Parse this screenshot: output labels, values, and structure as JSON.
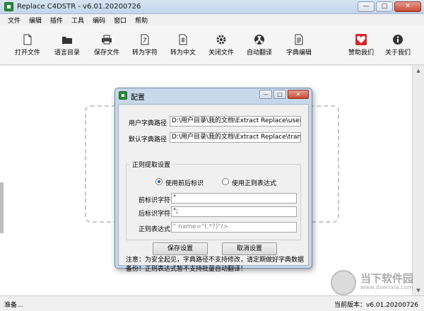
{
  "window": {
    "title": "Replace C4DSTR - v6.01.20200726",
    "minimize": "—",
    "maximize": "□",
    "close": "✕"
  },
  "menu": [
    "文件",
    "编辑",
    "插件",
    "工具",
    "编码",
    "窗口",
    "帮助"
  ],
  "toolbar": [
    {
      "label": "打开文件",
      "icon": "file-icon"
    },
    {
      "label": "语言目录",
      "icon": "folder-icon"
    },
    {
      "label": "保存文件",
      "icon": "printer-icon"
    },
    {
      "label": "转为字符",
      "icon": "convert-icon"
    },
    {
      "label": "转为中文",
      "icon": "convert-doc-icon"
    },
    {
      "label": "关闭文件",
      "icon": "gear-icon"
    },
    {
      "label": "自动翻译",
      "icon": "radiation-icon"
    },
    {
      "label": "字典编辑",
      "icon": "document-icon"
    },
    {
      "label": "赞助我们",
      "icon": "heart-icon"
    },
    {
      "label": "关于我们",
      "icon": "info-icon"
    }
  ],
  "status": {
    "left": "准备...",
    "right": "当前版本：v6.01.20200726"
  },
  "watermark": {
    "name": "当下软件园",
    "url": "www.downxia.com"
  },
  "dialog": {
    "title": "配置",
    "minimize": "—",
    "maximize": "□",
    "close": "✕",
    "user_dict_label": "用户字典路径",
    "user_dict_value": "D:\\用户目录\\我的文档\\Extract Replace\\user_t",
    "default_dict_label": "默认字典路径",
    "default_dict_value": "D:\\用户目录\\我的文档\\Extract Replace\\transla",
    "group_title": "正则提取设置",
    "radio_prefix_suffix": "使用前后标识",
    "radio_regex": "使用正则表达式",
    "prefix_label": "前标识字符",
    "prefix_value": "\"",
    "suffix_label": "后标识字符",
    "suffix_value": "\";",
    "regex_label": "正则表达式",
    "regex_value": "\" name=\"(.*?)\"/>",
    "save_button": "保存设置",
    "cancel_button": "取消设置",
    "note": "注意：为安全起见，字典路径不支持修改，请定期做好字典数据备份！正则表达式暂不支持批量自动翻译！"
  },
  "colors": {
    "accent": "#1d5fae",
    "heart": "#d8262c",
    "app_icon": "#2a8a3a"
  }
}
